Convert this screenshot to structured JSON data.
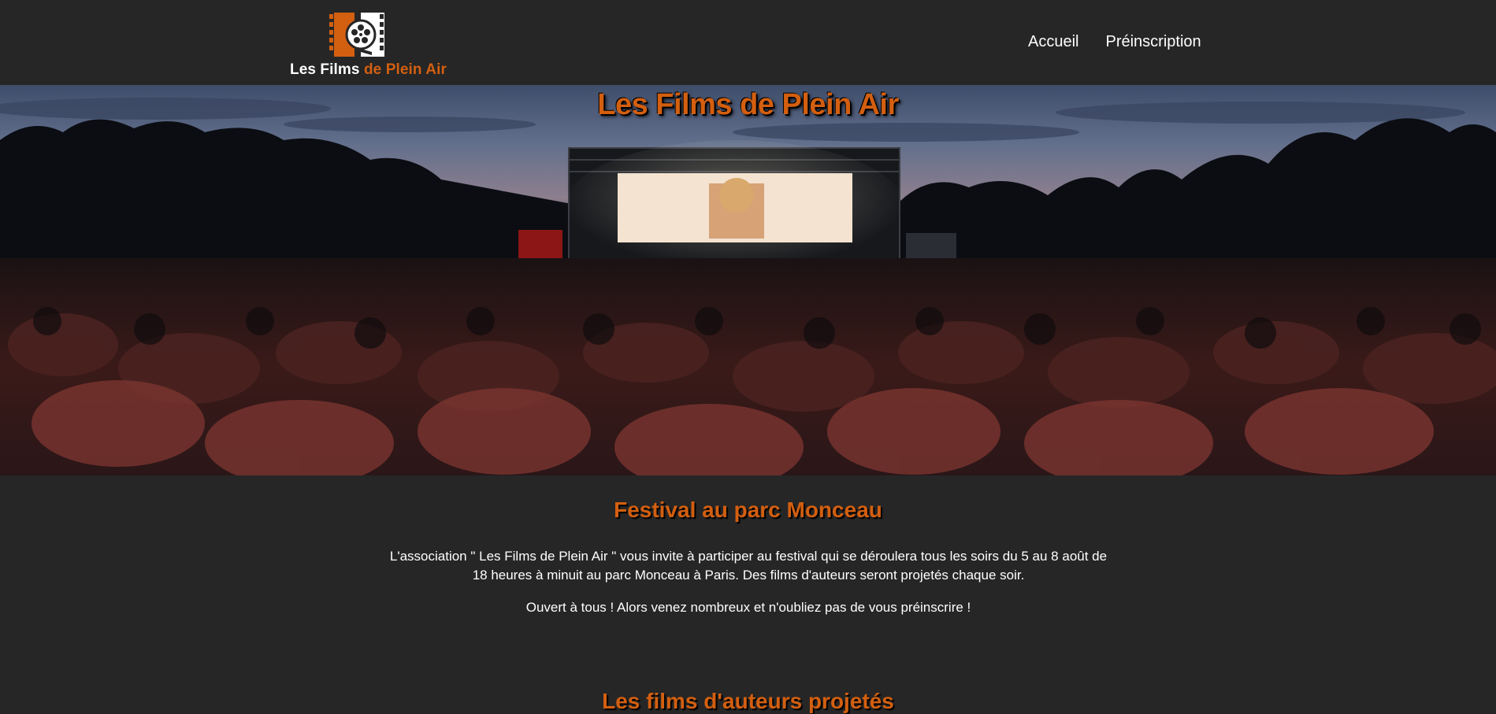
{
  "header": {
    "logo": {
      "text_part1": "Les Films",
      "text_part2": "de Plein Air",
      "icon": "film-reel-icon"
    },
    "nav": [
      {
        "label": "Accueil"
      },
      {
        "label": "Préinscription"
      }
    ]
  },
  "hero": {
    "title": "Les Films de Plein Air"
  },
  "intro": {
    "title": "Festival au parc Monceau",
    "paragraph1": "L'association \" Les Films de Plein Air \" vous invite à participer au festival qui se déroulera tous les soirs du 5 au 8 août de 18 heures à minuit au parc Monceau à Paris. Des films d'auteurs seront projetés chaque soir.",
    "paragraph2": "Ouvert à tous ! Alors venez nombreux et n'oubliez pas de vous préinscrire !"
  },
  "films": {
    "title": "Les films d'auteurs projetés"
  },
  "colors": {
    "background": "#262626",
    "accent": "#d35f10",
    "text": "#ffffff"
  }
}
